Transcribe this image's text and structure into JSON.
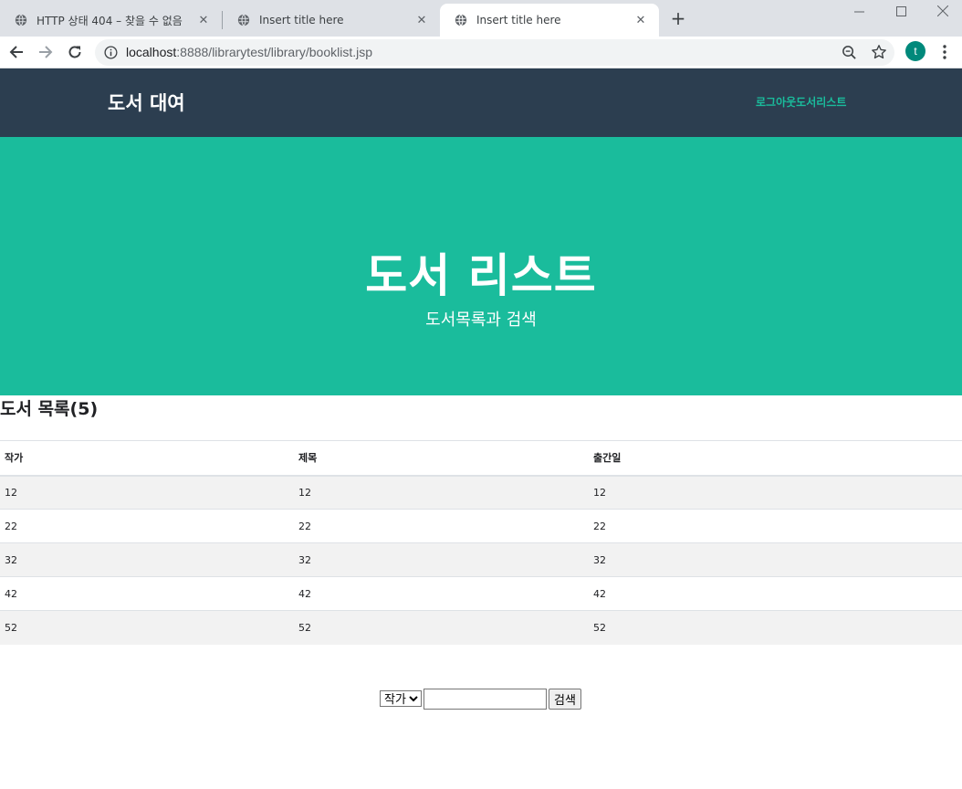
{
  "browser": {
    "tabs": [
      {
        "title": "HTTP 상태 404 – 찾을 수 없음",
        "active": false
      },
      {
        "title": "Insert title here",
        "active": false
      },
      {
        "title": "Insert title here",
        "active": true
      }
    ],
    "url_host": "localhost",
    "url_rest": ":8888/librarytest/library/booklist.jsp",
    "profile_initial": "t",
    "colors": {
      "tabstrip": "#dee1e6",
      "profile": "#00897b"
    }
  },
  "site": {
    "brand": "도서 대여",
    "nav": {
      "logout": "로그아웃",
      "booklist": "도서리스트"
    },
    "colors": {
      "nav_bg": "#2c3e50",
      "accent": "#1abc9c"
    }
  },
  "hero": {
    "title": "도서 리스트",
    "subtitle": "도서목록과 검색"
  },
  "list": {
    "title": "도서 목록(5)",
    "columns": [
      "작가",
      "제목",
      "출간일"
    ],
    "rows": [
      [
        "12",
        "12",
        "12"
      ],
      [
        "22",
        "22",
        "22"
      ],
      [
        "32",
        "32",
        "32"
      ],
      [
        "42",
        "42",
        "42"
      ],
      [
        "52",
        "52",
        "52"
      ]
    ]
  },
  "search": {
    "selected_field": "작가",
    "query": "",
    "button_label": "검색"
  }
}
